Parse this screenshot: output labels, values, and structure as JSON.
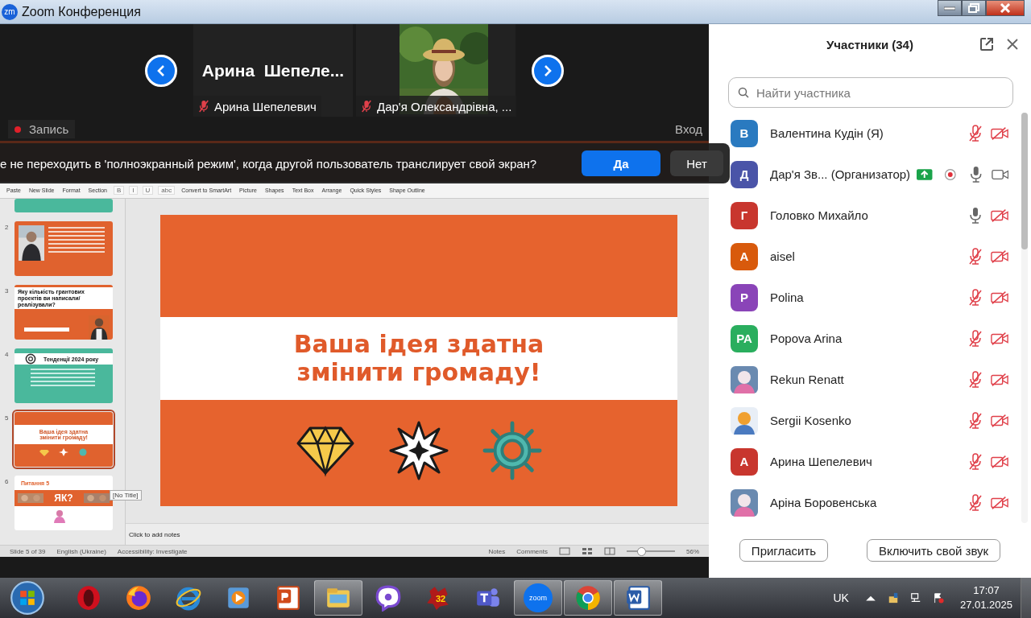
{
  "window": {
    "logo": "zm",
    "title": "Zoom Конференция"
  },
  "video_strip": {
    "tiles": [
      {
        "kind": "name",
        "big_name": "Арина  Шепеле...",
        "name": "Арина Шепелевич",
        "muted": true
      },
      {
        "kind": "picture",
        "name": "Дар'я Олександрівна, ...",
        "muted": true
      }
    ]
  },
  "record_button": {
    "label": "Запись"
  },
  "enter_label": "Вход",
  "prompt": {
    "text": "е не переходить в 'полноэкранный режим', когда другой пользователь транслирует свой экран?",
    "buttons": [
      {
        "label": "Да",
        "primary": true
      },
      {
        "label": "Нет",
        "primary": false
      }
    ]
  },
  "ribbon": {
    "items": [
      {
        "kind": "text",
        "label": "Paste"
      },
      {
        "kind": "text",
        "label": "New Slide"
      },
      {
        "kind": "text",
        "label": "Format"
      },
      {
        "kind": "text",
        "label": "Section"
      },
      {
        "kind": "format",
        "label": "B"
      },
      {
        "kind": "format",
        "label": "I"
      },
      {
        "kind": "format",
        "label": "U"
      },
      {
        "kind": "format",
        "label": "abc"
      },
      {
        "kind": "text",
        "label": "Convert to SmartArt"
      },
      {
        "kind": "text",
        "label": "Picture"
      },
      {
        "kind": "text",
        "label": "Shapes"
      },
      {
        "kind": "text",
        "label": "Text Box"
      },
      {
        "kind": "text",
        "label": "Arrange"
      },
      {
        "kind": "text",
        "label": "Quick Styles"
      },
      {
        "kind": "text",
        "label": "Shape Outline"
      }
    ]
  },
  "slides": {
    "thumbnails": [
      {
        "kind": "teal",
        "selected": false
      },
      {
        "number": "2",
        "kind": "speaker",
        "selected": false
      },
      {
        "number": "3",
        "kind": "question",
        "title": "Яку кількість грантових проектів ви написали/реалізували?",
        "selected": false
      },
      {
        "number": "4",
        "kind": "trends",
        "title": "Тенденції 2024 року",
        "selected": false
      },
      {
        "number": "5",
        "kind": "idea",
        "title": "Ваша ідея здатна змінити громаду!",
        "selected": true
      },
      {
        "number": "6",
        "kind": "how",
        "title": "ЯК?",
        "subtitle": "Питання 5",
        "selected": false
      }
    ],
    "tooltip": "[No Title]"
  },
  "slide": {
    "title_lines": [
      "Ваша ідея здатна",
      "змінити громаду!"
    ]
  },
  "notes": {
    "placeholder": "Click to add notes"
  },
  "status_bar": {
    "slide": "Slide 5 of 39",
    "language": "English (Ukraine)",
    "accessibility": "Accessibility: Investigate",
    "notes": "Notes",
    "comments": "Comments",
    "zoom": "56%",
    "level": 0.3
  },
  "participants": {
    "title": "Участники (34)",
    "search": {
      "placeholder": "Найти участника"
    },
    "items": [
      {
        "name": "Валентина Кудін (Я)",
        "kind": "initial",
        "initial": "В",
        "color": "#2a7ac0",
        "muted": true,
        "video_on": false,
        "sharing": false,
        "recording": false
      },
      {
        "name": "Дар'я Зв... (Организатор)",
        "kind": "initial",
        "initial": "Д",
        "color": "#4a54a8",
        "muted": false,
        "video_on": true,
        "sharing": true,
        "recording": true
      },
      {
        "name": "Головко Михайло",
        "kind": "initial",
        "initial": "Г",
        "color": "#c8362e",
        "muted": false,
        "video_on": false,
        "sharing": false,
        "recording": false
      },
      {
        "name": "aisel",
        "kind": "initial",
        "initial": "A",
        "color": "#d85a0c",
        "muted": true,
        "video_on": false,
        "sharing": false,
        "recording": false
      },
      {
        "name": "Polina",
        "kind": "initial",
        "initial": "P",
        "color": "#8a44b8",
        "muted": true,
        "video_on": false,
        "sharing": false,
        "recording": false
      },
      {
        "name": "Popova Arina",
        "kind": "initial",
        "initial": "PA",
        "color": "#2aae5e",
        "muted": true,
        "video_on": false,
        "sharing": false,
        "recording": false
      },
      {
        "name": "Rekun Renatt",
        "kind": "picture",
        "muted": true,
        "video_on": false,
        "sharing": false,
        "recording": false
      },
      {
        "name": "Sergii Kosenko",
        "kind": "picture",
        "muted": true,
        "video_on": false,
        "sharing": false,
        "recording": false
      },
      {
        "name": "Арина Шепелевич",
        "kind": "initial",
        "initial": "А",
        "color": "#c8362e",
        "muted": true,
        "video_on": false,
        "sharing": false,
        "recording": false
      },
      {
        "name": "Аріна Боровенська",
        "kind": "picture",
        "muted": true,
        "video_on": false,
        "sharing": false,
        "recording": false
      }
    ],
    "buttons": [
      "Пригласить",
      "Включить свой звук"
    ]
  },
  "taskbar": {
    "apps": [
      {
        "kind": "opera",
        "active": false
      },
      {
        "kind": "firefox",
        "active": false
      },
      {
        "kind": "ie",
        "active": false
      },
      {
        "kind": "media",
        "active": false
      },
      {
        "kind": "powerpoint",
        "active": false
      },
      {
        "kind": "explorer",
        "active": true
      },
      {
        "kind": "viber",
        "active": false
      },
      {
        "kind": "game",
        "label": "32",
        "active": false
      },
      {
        "kind": "teams",
        "active": false
      },
      {
        "kind": "zoom",
        "label": "zoom",
        "active": true
      },
      {
        "kind": "chrome",
        "active": true
      },
      {
        "kind": "word",
        "active": true
      }
    ],
    "language": "UK",
    "time": "17:07",
    "date": "27.01.2025"
  }
}
